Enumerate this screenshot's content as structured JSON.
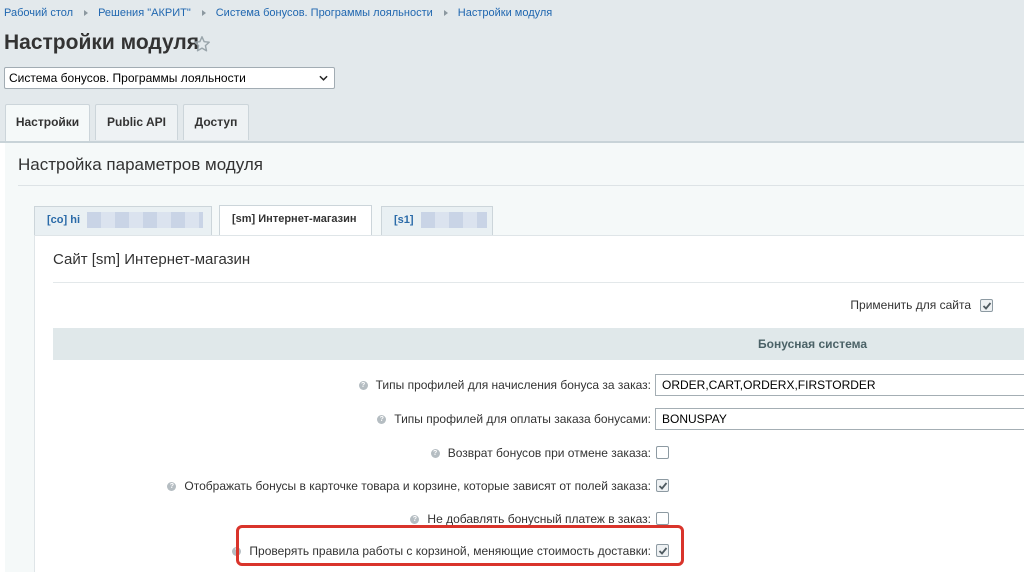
{
  "breadcrumb": {
    "items": [
      "Рабочий стол",
      "Решения \"АКРИТ\"",
      "Система бонусов. Программы лояльности",
      "Настройки модуля"
    ]
  },
  "page": {
    "title": "Настройки модуля"
  },
  "module_select": {
    "value": "Система бонусов. Программы лояльности"
  },
  "tabs": [
    {
      "label": "Настройки",
      "active": true
    },
    {
      "label": "Public API",
      "active": false
    },
    {
      "label": "Доступ",
      "active": false
    }
  ],
  "main": {
    "title": "Настройка параметров модуля"
  },
  "site_tabs": [
    {
      "label": "[co] hi",
      "active": false,
      "obscured": true
    },
    {
      "label": "[sm] Интернет-магазин",
      "active": true,
      "obscured": false
    },
    {
      "label": "[s1]",
      "active": false,
      "obscured": true
    }
  ],
  "site": {
    "title": "Сайт [sm] Интернет-магазин",
    "apply_label": "Применить для сайта",
    "apply_checked": true
  },
  "group": {
    "title": "Бонусная система"
  },
  "fields": [
    {
      "label": "Типы профилей для начисления бонуса за заказ:",
      "type": "text",
      "value": "ORDER,CART,ORDERX,FIRSTORDER",
      "help": true
    },
    {
      "label": "Типы профилей для оплаты заказа бонусами:",
      "type": "text",
      "value": "BONUSPAY",
      "help": true
    },
    {
      "label": "Возврат бонусов при отмене заказа:",
      "type": "checkbox",
      "checked": false,
      "help": true
    },
    {
      "label": "Отображать бонусы в карточке товара и корзине, которые зависят от полей заказа:",
      "type": "checkbox",
      "checked": true,
      "help": true
    },
    {
      "label": "Не добавлять бонусный платеж в заказ:",
      "type": "checkbox",
      "checked": false,
      "help": true
    },
    {
      "label": "Проверять правила работы с корзиной, меняющие стоимость доставки:",
      "type": "checkbox",
      "checked": true,
      "help": true,
      "highlighted": true
    }
  ],
  "colors": {
    "link": "#2067b0",
    "highlight": "#d9342b",
    "group_header_bg": "#e0e8ea",
    "page_bg": "#e3e9ec"
  },
  "icons": [
    "chevron-right-icon",
    "star-icon",
    "chevron-down-icon",
    "help-icon",
    "checkmark-icon"
  ]
}
